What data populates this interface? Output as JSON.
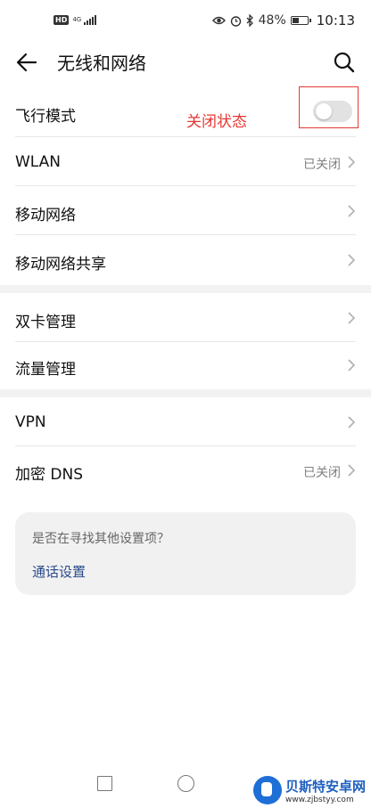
{
  "status_bar": {
    "hd": "HD",
    "network": "4G",
    "battery": "48%",
    "battery_level": 0.48,
    "time": "10:13"
  },
  "header": {
    "title": "无线和网络",
    "back_icon": "arrow-left-icon",
    "search_icon": "search-icon"
  },
  "rows": {
    "airplane": {
      "label": "飞行模式",
      "toggle_on": false
    },
    "wlan": {
      "label": "WLAN",
      "value": "已关闭"
    },
    "mobile_network": {
      "label": "移动网络"
    },
    "tethering": {
      "label": "移动网络共享"
    },
    "dual_sim": {
      "label": "双卡管理"
    },
    "data_usage": {
      "label": "流量管理"
    },
    "vpn": {
      "label": "VPN"
    },
    "private_dns": {
      "label": "加密 DNS",
      "value": "已关闭"
    }
  },
  "annotation": {
    "text": "关闭状态",
    "color": "#e53935"
  },
  "suggestion": {
    "question": "是否在寻找其他设置项？",
    "link": "通话设置"
  },
  "watermark": {
    "title": "贝斯特安卓网",
    "url": "www.zjbstyy.com"
  }
}
